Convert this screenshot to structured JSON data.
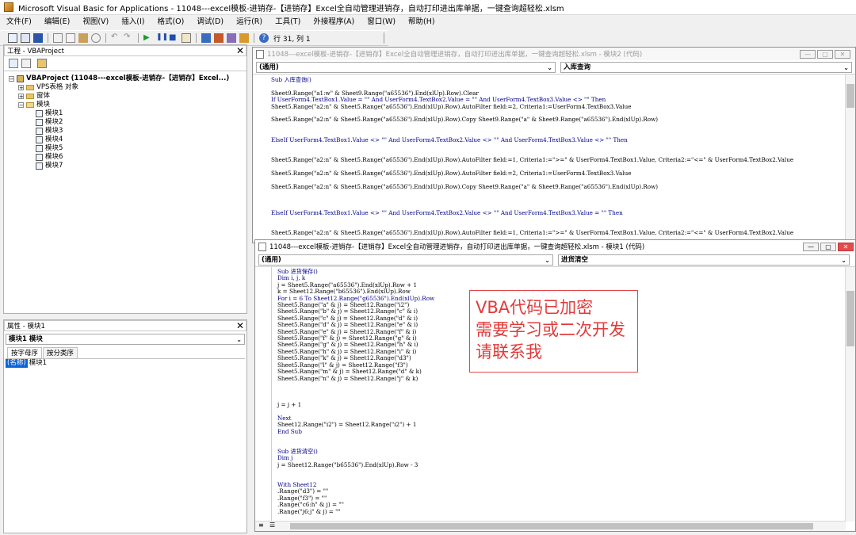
{
  "window": {
    "title": "Microsoft Visual Basic for Applications - 11048---excel模板-进销存-【进销存】Excel全自动管理进销存，自动打印进出库单据，一键查询超轻松.xlsm"
  },
  "menu": [
    "文件(F)",
    "编辑(E)",
    "视图(V)",
    "插入(I)",
    "格式(O)",
    "调试(D)",
    "运行(R)",
    "工具(T)",
    "外接程序(A)",
    "窗口(W)",
    "帮助(H)"
  ],
  "toolbar": {
    "position": "行 31, 列 1"
  },
  "project_panel": {
    "title": "工程 - VBAProject",
    "tree": {
      "root": "VBAProject (11048---excel模板-进销存-【进销存】Excel...)",
      "folders": [
        "VPS表格 对象",
        "窗体",
        "模块"
      ],
      "modules": [
        "模块1",
        "模块2",
        "模块3",
        "模块4",
        "模块5",
        "模块6",
        "模块7"
      ]
    }
  },
  "props_panel": {
    "title": "属性 - 模块1",
    "object": "模块1 模块",
    "tabs": [
      "按字母序",
      "按分类序"
    ],
    "row": {
      "key": "(名称)",
      "value": "模块1"
    }
  },
  "code_window_back": {
    "title": "11048---excel模板-进销存-【进销存】Excel全自动管理进销存，自动打印进出库单据，一键查询超轻松.xlsm - 模块2 (代码)",
    "object_dropdown": "(通用)",
    "proc_dropdown": "入库查询",
    "lines": [
      "Sub 入库查询()",
      "",
      "Sheet9.Range(\"a1:w\" & Sheet9.Range(\"a65536\").End(xlUp).Row).Clear",
      "If UserForm4.TextBox1.Value = \"\" And UserForm4.TextBox2.Value = \"\" And UserForm4.TextBox3.Value <> \"\" Then",
      "Sheet5.Range(\"a2:n\" & Sheet5.Range(\"a65536\").End(xlUp).Row).AutoFilter field:=2, Criteria1:=UserForm4.TextBox3.Value",
      "",
      "Sheet5.Range(\"a2:n\" & Sheet5.Range(\"a65536\").End(xlUp).Row).Copy Sheet9.Range(\"a\" & Sheet9.Range(\"a65536\").End(xlUp).Row)",
      "",
      "",
      "ElseIf UserForm4.TextBox1.Value <> \"\" And UserForm4.TextBox2.Value <> \"\" And UserForm4.TextBox3.Value <> \"\" Then",
      "",
      "",
      "Sheet5.Range(\"a2:n\" & Sheet5.Range(\"a65536\").End(xlUp).Row).AutoFilter field:=1, Criteria1:=\">=\" & UserForm4.TextBox1.Value, Criteria2:=\"<=\" & UserForm4.TextBox2.Value",
      "",
      "Sheet5.Range(\"a2:n\" & Sheet5.Range(\"a65536\").End(xlUp).Row).AutoFilter field:=2, Criteria1:=UserForm4.TextBox3.Value",
      "",
      "Sheet5.Range(\"a2:n\" & Sheet5.Range(\"a65536\").End(xlUp).Row).Copy Sheet9.Range(\"a\" & Sheet9.Range(\"a65536\").End(xlUp).Row)",
      "",
      "",
      "",
      "ElseIf UserForm4.TextBox1.Value <> \"\" And UserForm4.TextBox2.Value <> \"\" And UserForm4.TextBox3.Value = \"\" Then",
      "",
      "",
      "Sheet5.Range(\"a2:n\" & Sheet5.Range(\"a65536\").End(xlUp).Row).AutoFilter field:=1, Criteria1:=\">=\" & UserForm4.TextBox1.Value, Criteria2:=\"<=\" & UserForm4.TextBox2.Value"
    ]
  },
  "code_window_front": {
    "title": "11048---excel模板-进销存-【进销存】Excel全自动管理进销存，自动打印进出库单据，一键查询超轻松.xlsm - 模块1 (代码)",
    "object_dropdown": "(通用)",
    "proc_dropdown": "进货清空",
    "lines": [
      "Sub 进货保存()",
      "Dim i, j, k",
      "j = Sheet5.Range(\"a65536\").End(xlUp).Row + 1",
      "k = Sheet12.Range(\"b65536\").End(xlUp).Row",
      "For i = 6 To Sheet12.Range(\"g65536\").End(xlUp).Row",
      "Sheet5.Range(\"a\" & j) = Sheet12.Range(\"i2\")",
      "Sheet5.Range(\"b\" & j) = Sheet12.Range(\"c\" & i)",
      "Sheet5.Range(\"c\" & j) = Sheet12.Range(\"d\" & i)",
      "Sheet5.Range(\"d\" & j) = Sheet12.Range(\"e\" & i)",
      "Sheet5.Range(\"e\" & j) = Sheet12.Range(\"f\" & i)",
      "Sheet5.Range(\"f\" & j) = Sheet12.Range(\"g\" & i)",
      "Sheet5.Range(\"g\" & j) = Sheet12.Range(\"h\" & i)",
      "Sheet5.Range(\"h\" & j) = Sheet12.Range(\"i\" & i)",
      "Sheet5.Range(\"k\" & j) = Sheet12.Range(\"d3\")",
      "Sheet5.Range(\"l\" & j) = Sheet12.Range(\"f3\")",
      "Sheet5.Range(\"m\" & j) = Sheet12.Range(\"d\" & k)",
      "Sheet5.Range(\"n\" & j) = Sheet12.Range(\"j\" & k)",
      "",
      "",
      "",
      "j = j + 1",
      "",
      "Next",
      "Sheet12.Range(\"i2\") = Sheet12.Range(\"i2\") + 1",
      "End Sub",
      "",
      "",
      "Sub 进货清空()",
      "Dim j",
      "j = Sheet12.Range(\"b65536\").End(xlUp).Row - 3",
      "",
      "",
      "With Sheet12",
      ".Range(\"d3\") = \"\"",
      ".Range(\"f3\") = \"\"",
      ".Range(\"c6:h\" & j) = \"\"",
      ".Range(\"j6:j\" & j) = \"\""
    ]
  },
  "notice": {
    "line1": "VBA代码已加密",
    "line2": "需要学习或二次开发",
    "line3": "请联系我"
  }
}
